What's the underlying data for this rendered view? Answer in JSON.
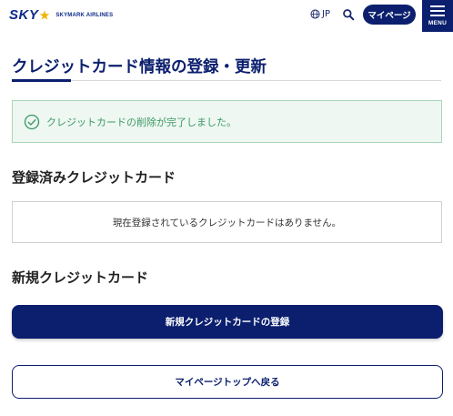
{
  "header": {
    "logo_text": "SKY",
    "logo_subtext": "SKYMARK AIRLINES",
    "language": "JP",
    "mypage_label": "マイページ",
    "menu_label": "MENU"
  },
  "page": {
    "title": "クレジットカード情報の登録・更新"
  },
  "notice": {
    "message": "クレジットカードの削除が完了しました。",
    "icon": "check-circle-icon"
  },
  "registered": {
    "heading": "登録済みクレジットカード",
    "empty_message": "現在登録されているクレジットカードはありません。"
  },
  "new_card": {
    "heading": "新規クレジットカード",
    "register_button": "新規クレジットカードの登録"
  },
  "back_button": "マイページトップへ戻る",
  "colors": {
    "brand_navy": "#0b1f6e",
    "success_green": "#3c9a63",
    "success_bg": "#eef7f2",
    "logo_star": "#f0b400"
  }
}
